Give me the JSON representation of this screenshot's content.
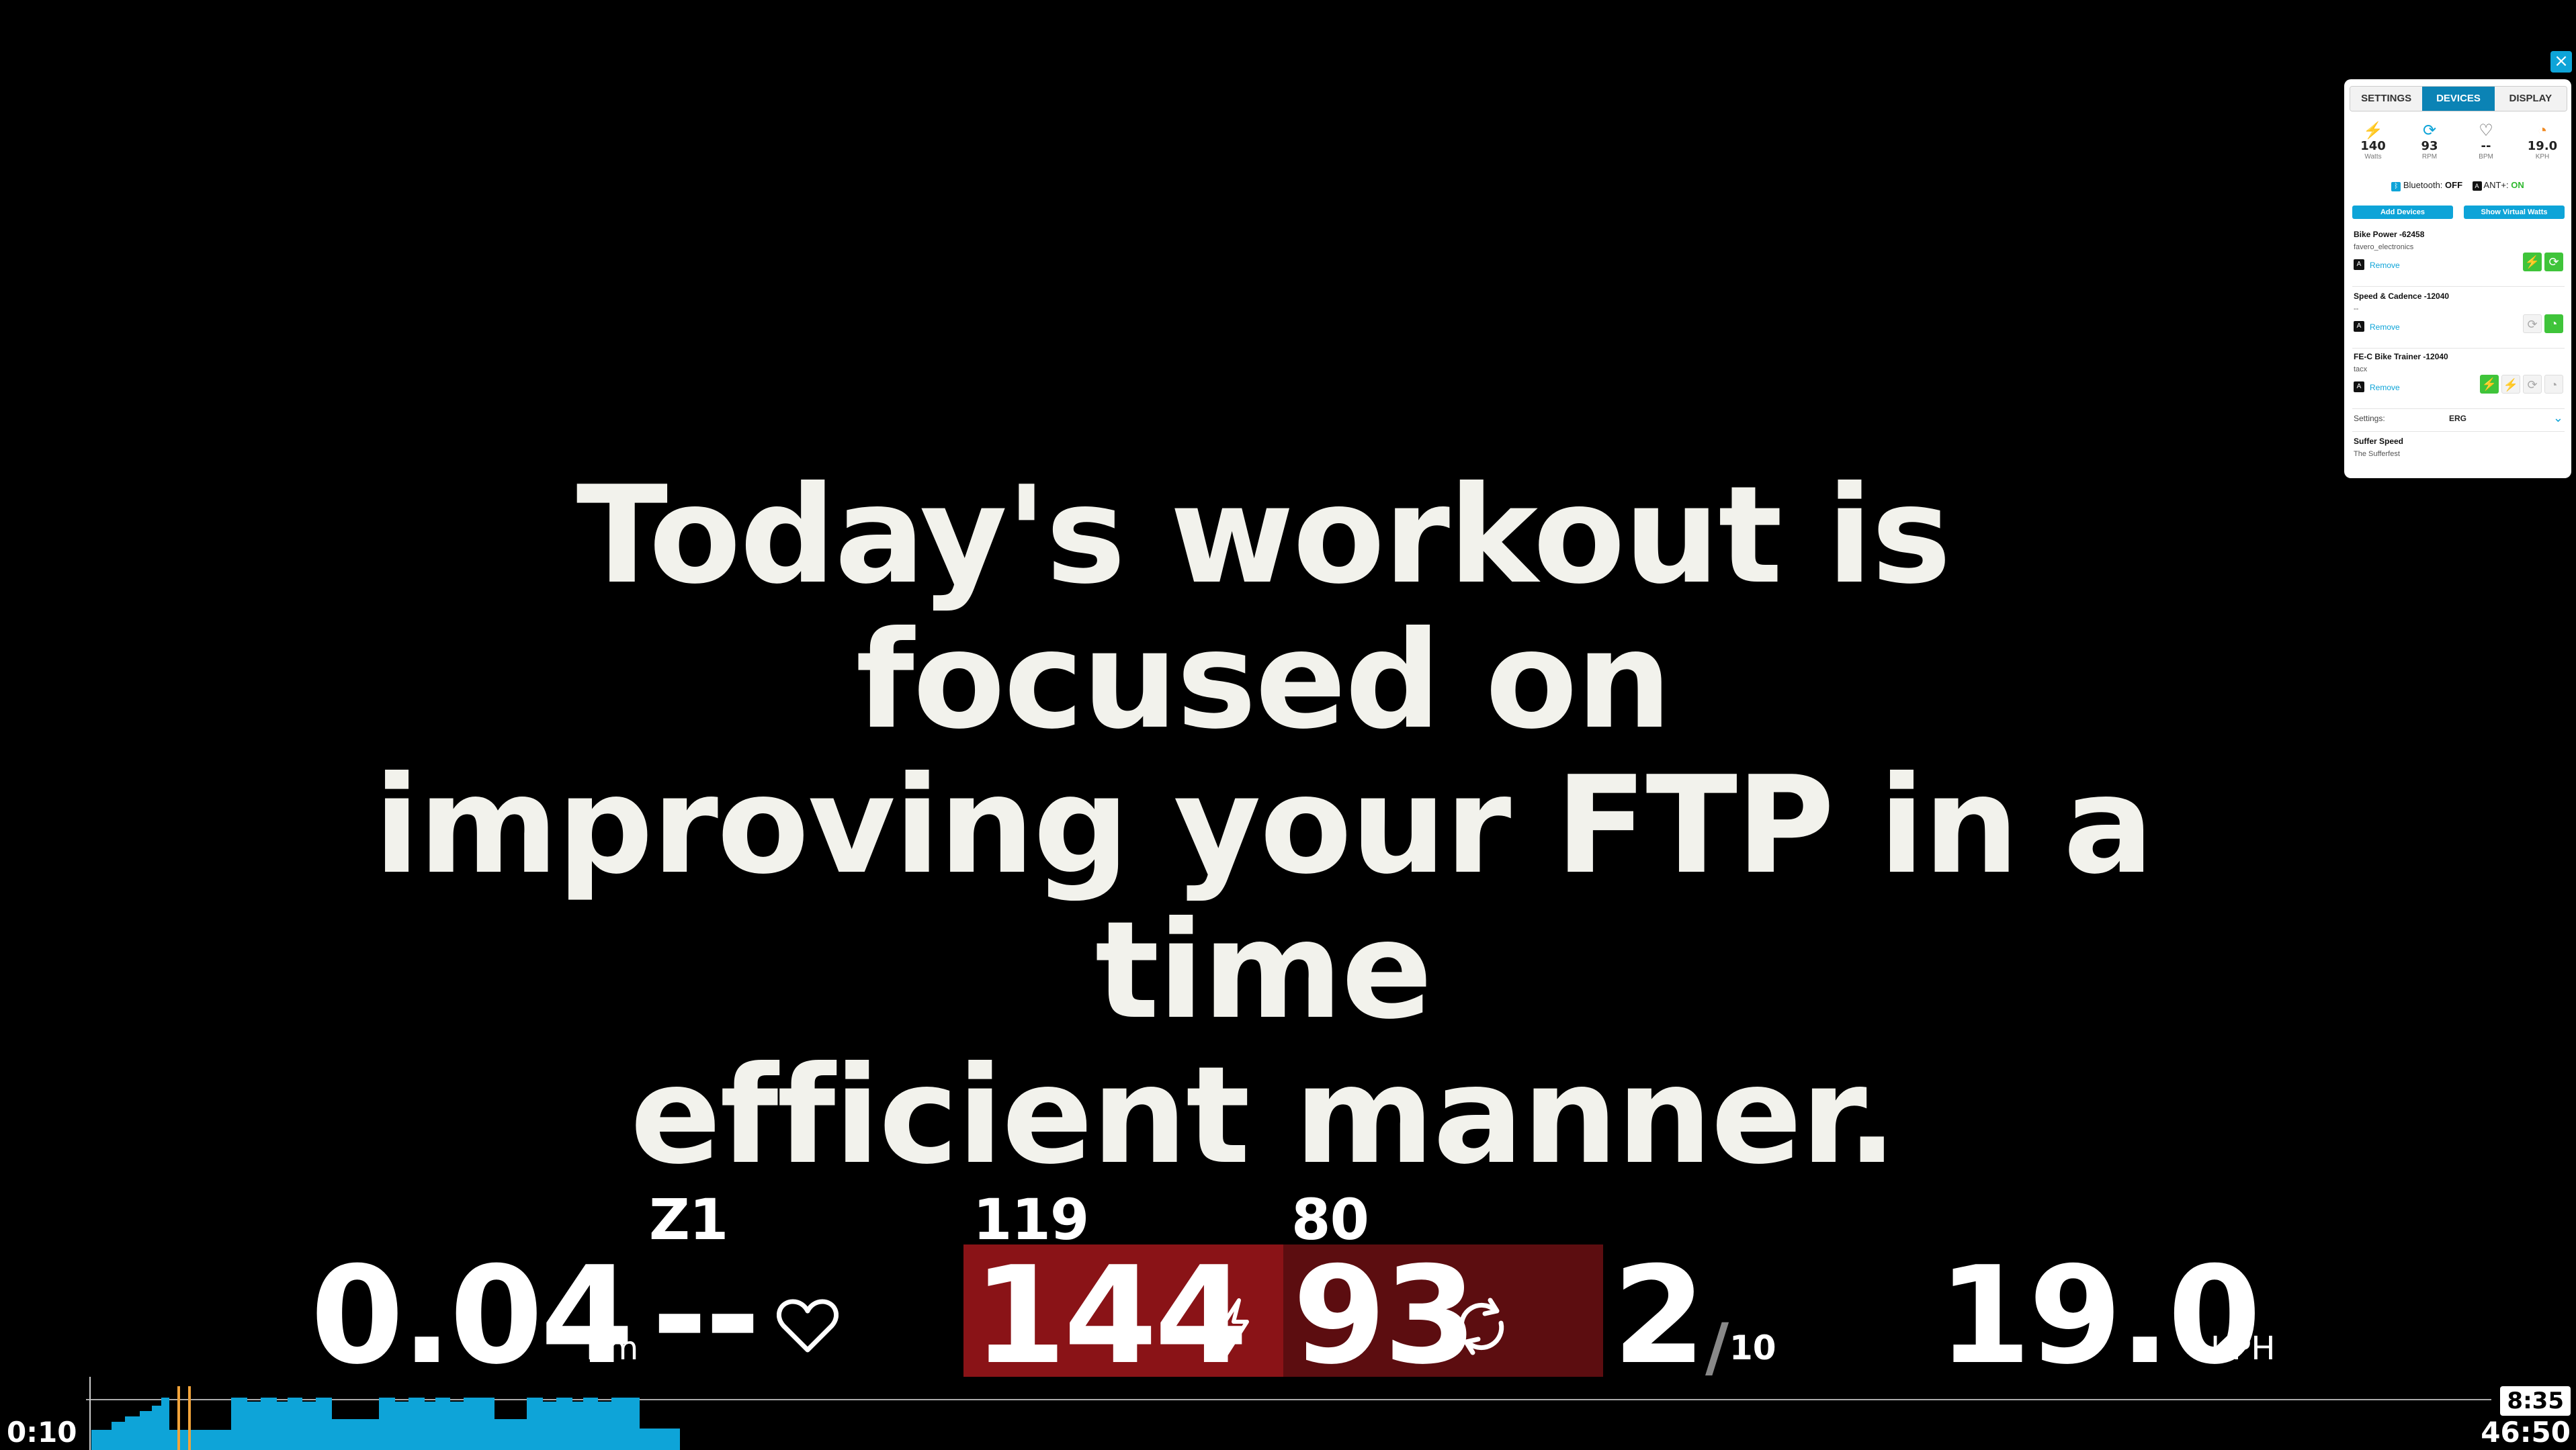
{
  "message": {
    "line1": "Today's workout is focused on",
    "line2": "improving your FTP in a time",
    "line3": "efficient manner."
  },
  "metrics": {
    "distance": {
      "value": "0.04",
      "unit": "Km"
    },
    "heart_rate": {
      "zone": "Z1",
      "value": "--"
    },
    "power": {
      "target": "119",
      "value": "144"
    },
    "cadence": {
      "target": "80",
      "value": "93"
    },
    "interval": {
      "current": "2",
      "total": "10"
    },
    "speed": {
      "value": "19.0",
      "unit": "KPH"
    }
  },
  "timeline": {
    "elapsed": "0:10",
    "segment_remaining": "8:35",
    "total_remaining": "46:50",
    "progress_fraction": 0.0036,
    "bar_color": "#0ea4d8"
  },
  "panel": {
    "close_label": "×",
    "tabs": [
      {
        "label": "SETTINGS",
        "active": false
      },
      {
        "label": "DEVICES",
        "active": true
      },
      {
        "label": "DISPLAY",
        "active": false
      }
    ],
    "stats": [
      {
        "icon": "power-icon",
        "value": "140",
        "label": "Watts"
      },
      {
        "icon": "cadence-icon",
        "value": "93",
        "label": "RPM"
      },
      {
        "icon": "heart-icon",
        "value": "--",
        "label": "BPM"
      },
      {
        "icon": "speed-icon",
        "value": "19.0",
        "label": "KPH"
      }
    ],
    "bluetooth": {
      "label": "Bluetooth:",
      "state": "OFF"
    },
    "ant": {
      "label": "ANT+:",
      "state": "ON"
    },
    "add_devices": "Add Devices",
    "show_virtual_watts": "Show Virtual Watts",
    "devices": [
      {
        "name": "Bike Power -62458",
        "mfr": "favero_electronics",
        "remove": "Remove"
      },
      {
        "name": "Speed & Cadence -12040",
        "mfr": "--",
        "remove": "Remove"
      },
      {
        "name": "FE-C Bike Trainer -12040",
        "mfr": "tacx",
        "remove": "Remove"
      }
    ],
    "settings": {
      "label": "Settings:",
      "value": "ERG"
    },
    "suffer_speed": {
      "name": "Suffer Speed",
      "mfr": "The Sufferfest"
    },
    "colors": {
      "accent": "#0ea4d8",
      "active_tab": "#0b83b5",
      "on": "#3fc43a"
    }
  }
}
